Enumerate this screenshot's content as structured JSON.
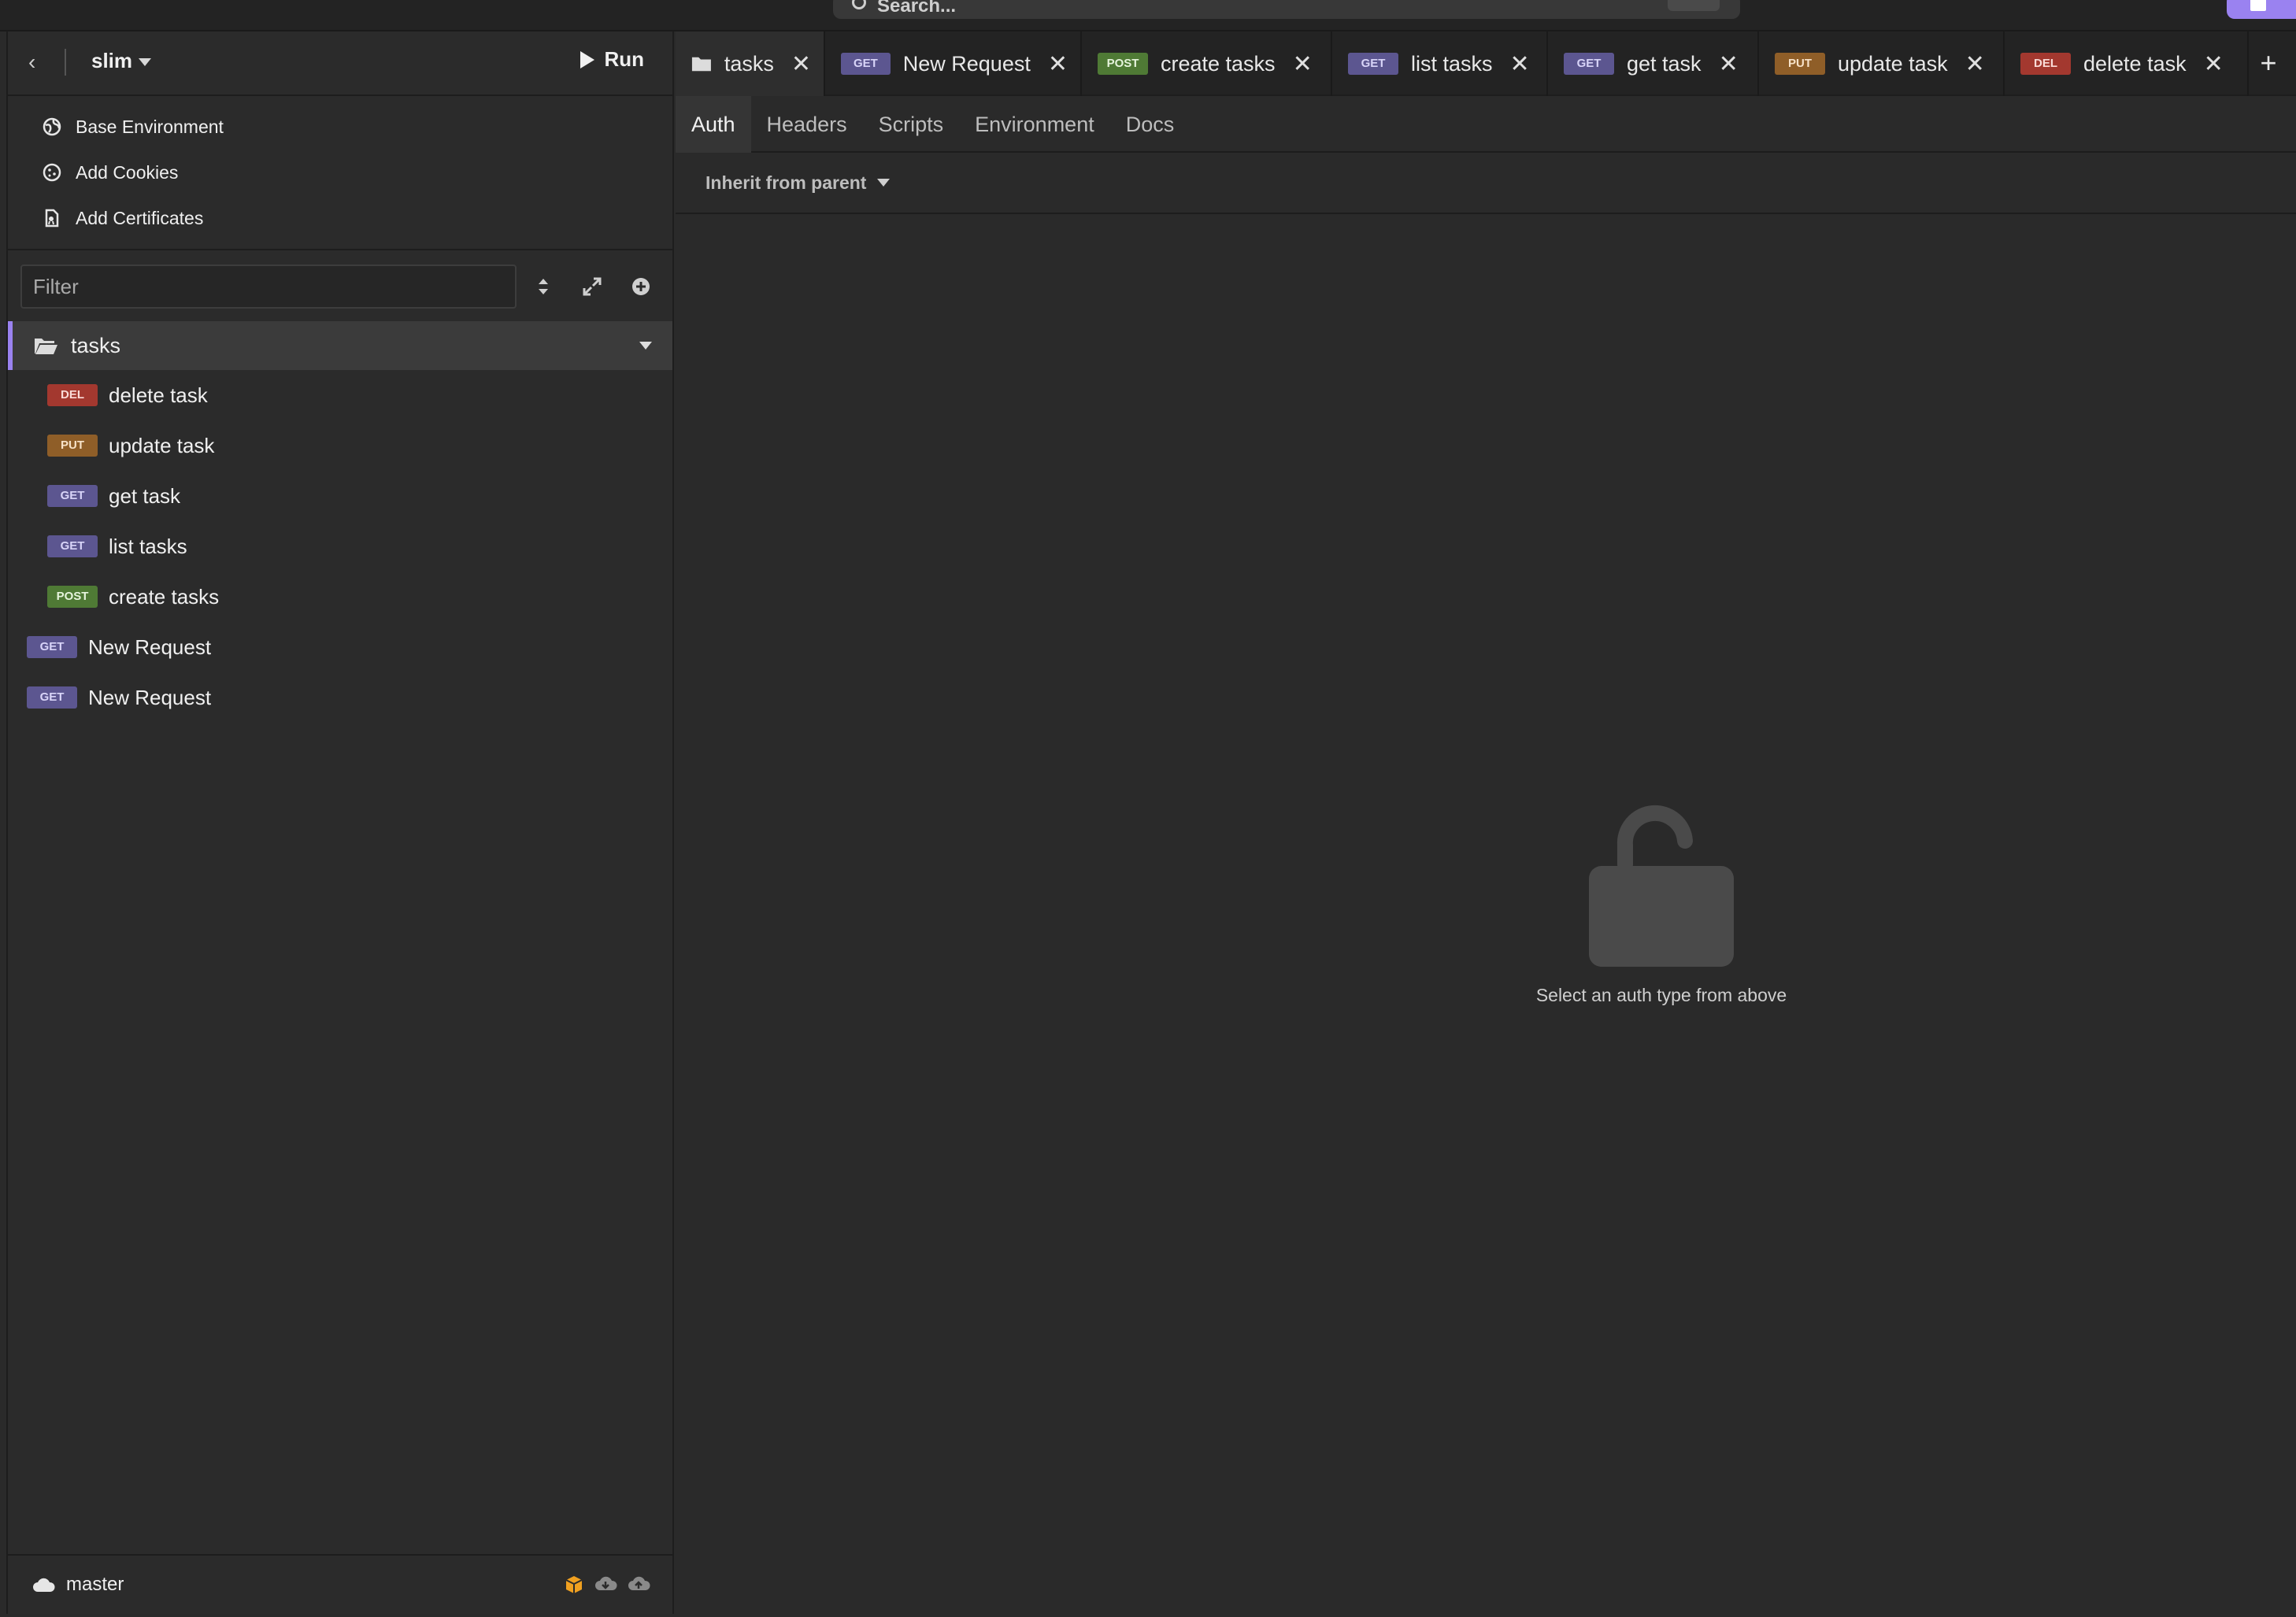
{
  "topbar": {
    "search_placeholder": "Search..."
  },
  "sidebar": {
    "workspace_name": "slim",
    "run_label": "Run",
    "env_items": [
      {
        "label": "Base Environment",
        "icon": "globe-icon"
      },
      {
        "label": "Add Cookies",
        "icon": "cookie-icon"
      },
      {
        "label": "Add Certificates",
        "icon": "certificate-icon"
      }
    ],
    "filter_placeholder": "Filter",
    "folder": {
      "name": "tasks"
    },
    "requests": [
      {
        "method": "DEL",
        "name": "delete task"
      },
      {
        "method": "PUT",
        "name": "update task"
      },
      {
        "method": "GET",
        "name": "get task"
      },
      {
        "method": "GET",
        "name": "list tasks"
      },
      {
        "method": "POST",
        "name": "create tasks"
      }
    ],
    "root_requests": [
      {
        "method": "GET",
        "name": "New Request"
      },
      {
        "method": "GET",
        "name": "New Request"
      }
    ],
    "footer": {
      "branch": "master"
    }
  },
  "tabs": [
    {
      "method": "",
      "name": "tasks",
      "active": true
    },
    {
      "method": "GET",
      "name": "New Request"
    },
    {
      "method": "POST",
      "name": "create tasks"
    },
    {
      "method": "GET",
      "name": "list tasks"
    },
    {
      "method": "GET",
      "name": "get task"
    },
    {
      "method": "PUT",
      "name": "update task"
    },
    {
      "method": "DEL",
      "name": "delete task"
    }
  ],
  "subtabs": [
    "Auth",
    "Headers",
    "Scripts",
    "Environment",
    "Docs"
  ],
  "auth": {
    "selector_label": "Inherit from parent",
    "empty_hint": "Select an auth type from above"
  },
  "colors": {
    "accent": "#9a82f0",
    "get": "#5c5690",
    "post": "#4f7a35",
    "put": "#8f5e28",
    "del": "#a3382f"
  }
}
